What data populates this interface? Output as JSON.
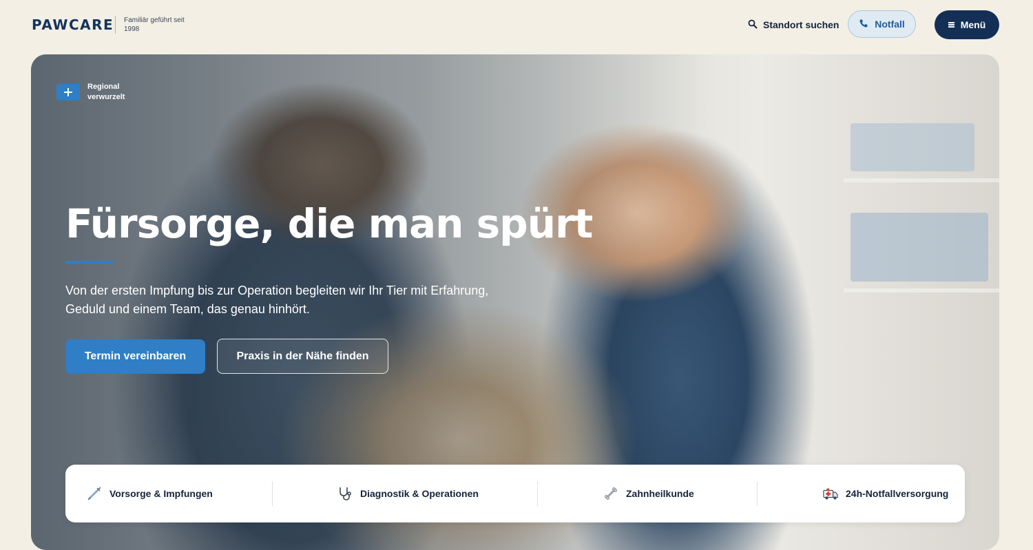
{
  "header": {
    "logo_paw": "PAW",
    "logo_care": "CARE",
    "tagline": "Familiär geführt seit 1998",
    "search_label": "Standort suchen",
    "emergency_label": "Notfall",
    "menu_label": "Menü"
  },
  "hero": {
    "badge_text": "Regional verwurzelt",
    "headline": "Fürsorge, die man spürt",
    "lead": "Von der ersten Impfung bis zur Operation begleiten wir Ihr Tier mit Erfahrung, Geduld und einem Team, das genau hinhört.",
    "primary_button": "Termin vereinbaren",
    "secondary_button": "Praxis in der Nähe finden"
  },
  "services": {
    "items": [
      {
        "label": "Vorsorge & Impfungen",
        "icon": "syringe-icon"
      },
      {
        "label": "Diagnostik & Operationen",
        "icon": "stethoscope-icon"
      },
      {
        "label": "Zahnheilkunde",
        "icon": "bone-icon"
      },
      {
        "label": "24h-Notfallversorgung",
        "icon": "ambulance-icon"
      }
    ]
  },
  "colors": {
    "brand_navy": "#142f55",
    "accent_blue": "#2f7ec6",
    "background": "#f3efe5"
  }
}
